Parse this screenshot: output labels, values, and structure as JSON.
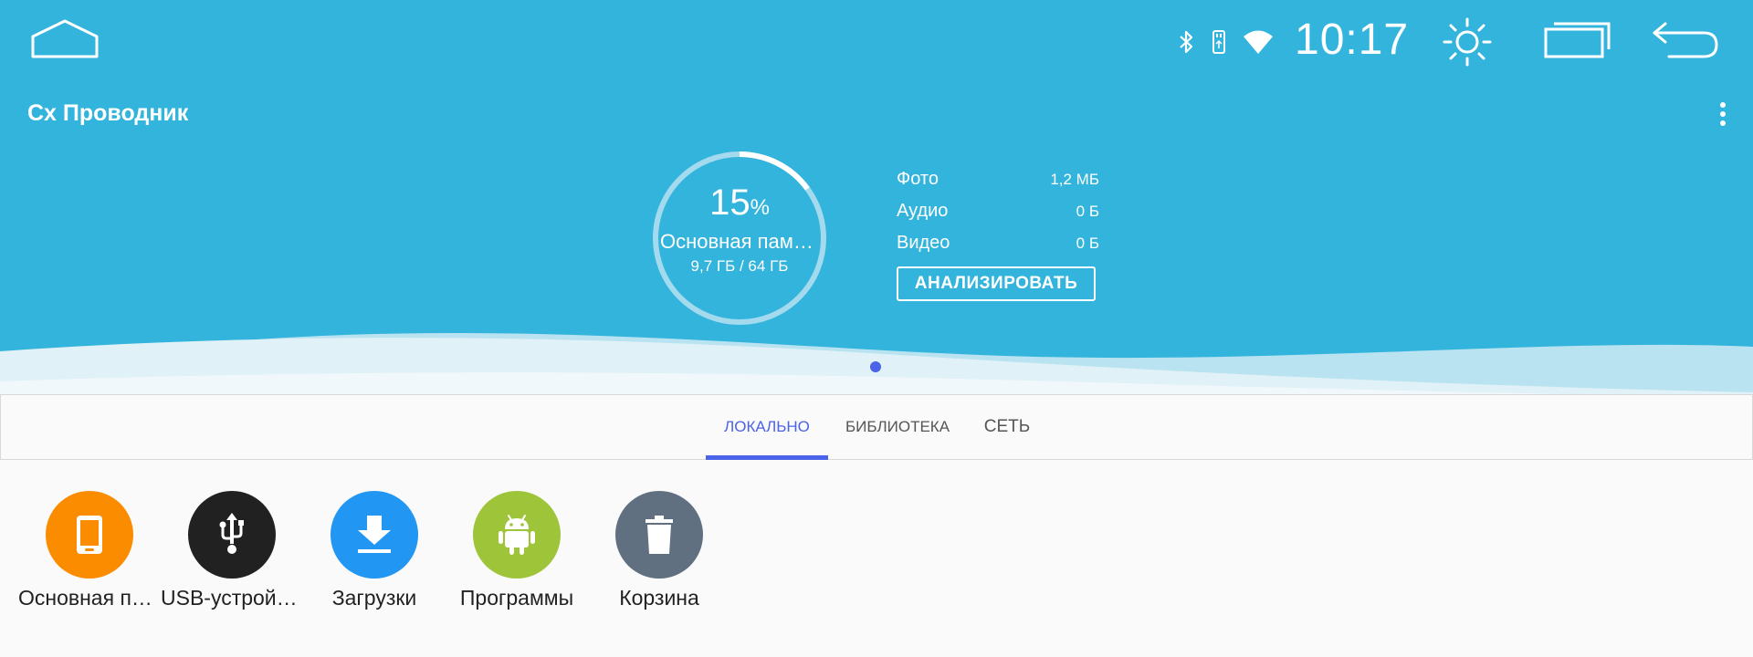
{
  "system_bar": {
    "time": "10:17",
    "icons": [
      "bluetooth-icon",
      "usb-drive-icon",
      "wifi-icon"
    ],
    "buttons": [
      "home-icon",
      "brightness-icon",
      "recent-apps-icon",
      "back-icon"
    ]
  },
  "app": {
    "title": "Cx Проводник"
  },
  "storage": {
    "percent": "15",
    "percent_sign": "%",
    "percent_value": 15,
    "name": "Основная память",
    "usage": "9,7 ГБ / 64 ГБ"
  },
  "stats": [
    {
      "label": "Фото",
      "value": "1,2 МБ"
    },
    {
      "label": "Аудио",
      "value": "0 Б"
    },
    {
      "label": "Видео",
      "value": "0 Б"
    }
  ],
  "analyze_button": "АНАЛИЗИРОВАТЬ",
  "tabs": [
    {
      "label": "ЛОКАЛЬНО",
      "active": true
    },
    {
      "label": "БИБЛИОТЕКА",
      "active": false
    },
    {
      "label": "СЕТЬ",
      "active": false
    }
  ],
  "locations": [
    {
      "label": "Основная память",
      "icon": "tablet-icon",
      "color": "#fb8c00"
    },
    {
      "label": "USB-устройство",
      "icon": "usb-icon",
      "color": "#212121"
    },
    {
      "label": "Загрузки",
      "icon": "download-icon",
      "color": "#2196f3"
    },
    {
      "label": "Программы",
      "icon": "android-icon",
      "color": "#9ec43a"
    },
    {
      "label": "Корзина",
      "icon": "trash-icon",
      "color": "#607080"
    }
  ],
  "colors": {
    "header": "#33b4dc",
    "accent": "#4a63e8",
    "background": "#fafafa"
  }
}
